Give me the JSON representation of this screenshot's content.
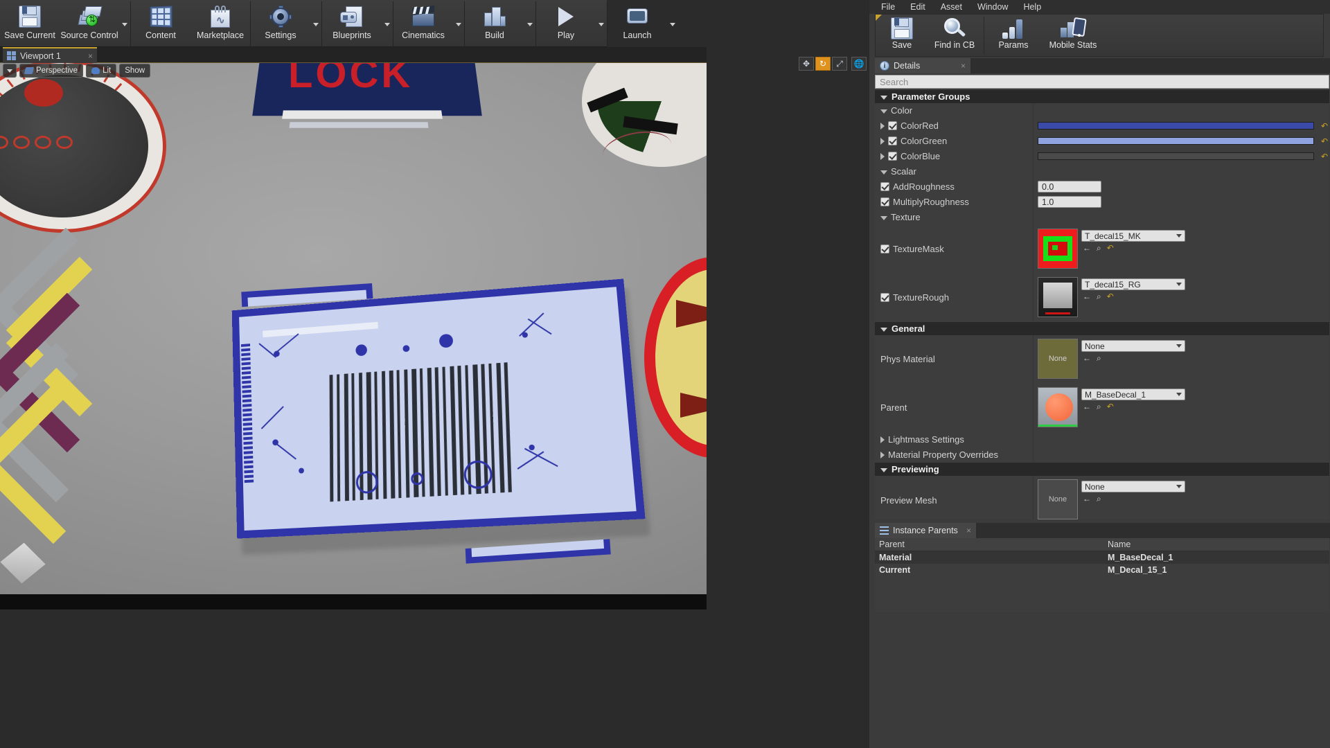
{
  "main_toolbar": {
    "buttons": [
      {
        "label": "Save Current",
        "icon": "floppy-disk-icon",
        "caret": false
      },
      {
        "label": "Source Control",
        "icon": "source-control-icon",
        "caret": true
      },
      {
        "label": "Content",
        "icon": "content-browser-icon",
        "caret": false
      },
      {
        "label": "Marketplace",
        "icon": "marketplace-bag-icon",
        "caret": false
      },
      {
        "label": "Settings",
        "icon": "gear-icon",
        "caret": true
      },
      {
        "label": "Blueprints",
        "icon": "blueprint-icon",
        "caret": true
      },
      {
        "label": "Cinematics",
        "icon": "clapperboard-icon",
        "caret": true
      },
      {
        "label": "Build",
        "icon": "build-icon",
        "caret": true
      },
      {
        "label": "Play",
        "icon": "play-icon",
        "caret": true
      },
      {
        "label": "Launch",
        "icon": "launch-icon",
        "caret": true
      }
    ]
  },
  "viewport": {
    "tab_label": "Viewport 1",
    "tab_close": "×",
    "controls": {
      "perspective": "Perspective",
      "lit": "Lit",
      "show": "Show"
    },
    "gizmos": [
      "move-gizmo-icon",
      "rotate-gizmo-icon",
      "scale-gizmo-icon",
      "world-coords-icon"
    ]
  },
  "menubar": {
    "items": [
      "File",
      "Edit",
      "Asset",
      "Window",
      "Help"
    ]
  },
  "mat_toolbar": {
    "buttons": [
      {
        "label": "Save",
        "icon": "floppy-disk-icon"
      },
      {
        "label": "Find in CB",
        "icon": "magnifier-icon"
      },
      {
        "label": "Params",
        "icon": "params-bars-icon"
      },
      {
        "label": "Mobile Stats",
        "icon": "mobile-stats-icon"
      }
    ]
  },
  "details": {
    "tab_label": "Details",
    "tab_close": "×",
    "search_placeholder": "Search",
    "parameter_groups_header": "Parameter Groups",
    "groups": [
      {
        "name": "Color",
        "params": [
          {
            "label": "ColorRed",
            "checked": true,
            "expandable": true,
            "widget": "colorbar",
            "color": "#3b4aa8",
            "reset": "↶"
          },
          {
            "label": "ColorGreen",
            "checked": true,
            "expandable": true,
            "widget": "colorbar",
            "color": "#8fa3e0",
            "reset": "↶"
          },
          {
            "label": "ColorBlue",
            "checked": true,
            "expandable": true,
            "widget": "colorbar",
            "color": "#4a4a4a",
            "reset": "↶"
          }
        ]
      },
      {
        "name": "Scalar",
        "params": [
          {
            "label": "AddRoughness",
            "checked": true,
            "expandable": false,
            "widget": "number",
            "value": "0.0",
            "reset": "↶"
          },
          {
            "label": "MultiplyRoughness",
            "checked": true,
            "expandable": false,
            "widget": "number",
            "value": "1.0",
            "reset": "↶"
          }
        ]
      },
      {
        "name": "Texture",
        "params": [
          {
            "label": "TextureMask",
            "checked": true,
            "expandable": false,
            "widget": "asset",
            "asset": "T_decal15_MK",
            "thumb": "mask-thumb"
          },
          {
            "label": "TextureRough",
            "checked": true,
            "expandable": false,
            "widget": "asset",
            "asset": "T_decal15_RG",
            "thumb": "rough-thumb"
          }
        ]
      }
    ],
    "general": {
      "header": "General",
      "rows": [
        {
          "label": "Phys Material",
          "asset": "None",
          "thumb": "phys-thumb",
          "thumb_text": "None"
        },
        {
          "label": "Parent",
          "asset": "M_BaseDecal_1",
          "thumb": "parent-thumb",
          "thumb_text": ""
        }
      ],
      "collapsed": [
        {
          "label": "Lightmass Settings"
        },
        {
          "label": "Material Property Overrides"
        }
      ]
    },
    "previewing": {
      "header": "Previewing",
      "rows": [
        {
          "label": "Preview Mesh",
          "asset": "None",
          "thumb": "none-thumb",
          "thumb_text": "None"
        }
      ]
    }
  },
  "instance_parents": {
    "tab_label": "Instance Parents",
    "tab_close": "×",
    "columns": [
      "Parent",
      "Name"
    ],
    "rows": [
      {
        "parent": "Material",
        "name": "M_BaseDecal_1"
      },
      {
        "parent": "Current",
        "name": "M_Decal_15_1"
      }
    ]
  },
  "icons": {
    "reset_arrow": "↶",
    "back_arrow": "←",
    "browse": "⌕",
    "use_selected": "↶"
  }
}
